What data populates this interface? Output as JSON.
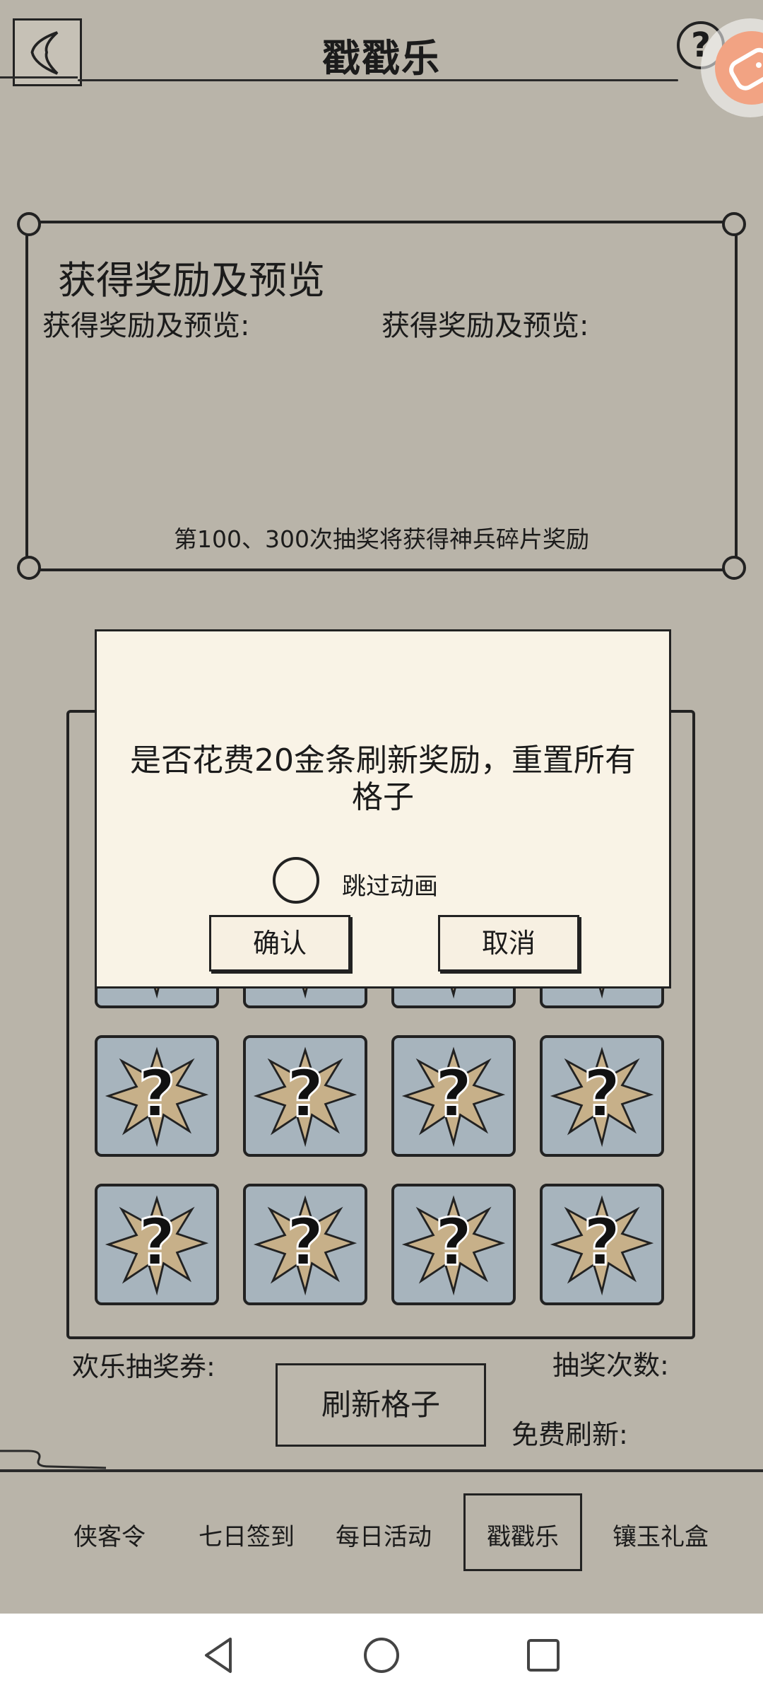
{
  "header": {
    "title": "戳戳乐",
    "help_label": "?"
  },
  "reward_panel": {
    "title": "获得奖励及预览",
    "subtitle_left": "获得奖励及预览:",
    "subtitle_right": "获得奖励及预览:",
    "note": "第100、300次抽奖将获得神兵碎片奖励"
  },
  "grid": {
    "rows": 4,
    "cols": 4,
    "hidden_cell_symbol": "?"
  },
  "footer_info": {
    "ticket_label": "欢乐抽奖券:",
    "draw_count_label": "抽奖次数:",
    "refresh_button": "刷新格子",
    "free_refresh_label": "免费刷新:"
  },
  "tabs": [
    {
      "label": "侠客令",
      "active": false
    },
    {
      "label": "七日签到",
      "active": false
    },
    {
      "label": "每日活动",
      "active": false
    },
    {
      "label": "戳戳乐",
      "active": true
    },
    {
      "label": "镶玉礼盒",
      "active": false
    }
  ],
  "modal": {
    "message": "是否花费20金条刷新奖励，重置所有格子",
    "skip_animation_label": "跳过动画",
    "skip_animation_checked": false,
    "confirm_label": "确认",
    "cancel_label": "取消"
  },
  "system_nav": {
    "back_icon": "triangle-back-icon",
    "home_icon": "circle-home-icon",
    "recents_icon": "square-recents-icon"
  },
  "colors": {
    "background": "#b9b4a9",
    "modal_background": "#f9f3e6",
    "cell_background": "#a7b4bd",
    "burst_color": "#c7b089",
    "game_bubble": "#f2a383"
  }
}
